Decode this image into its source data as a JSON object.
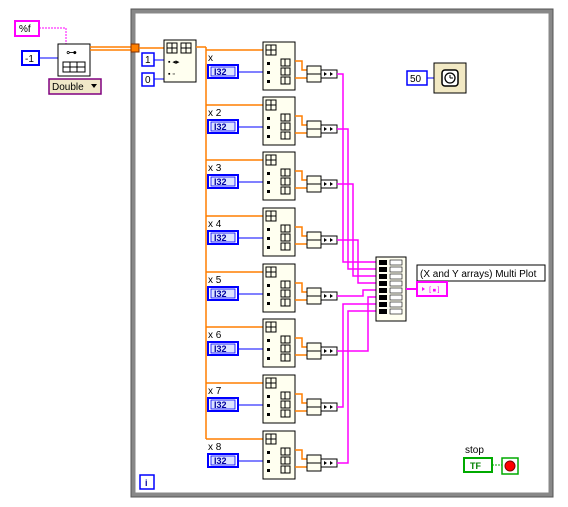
{
  "format_string": "%f",
  "row_constant": "-1",
  "type_selector": "Double",
  "index_start": "1",
  "index_zero": "0",
  "rows": [
    {
      "label": "x",
      "type": "I32"
    },
    {
      "label": "x 2",
      "type": "I32"
    },
    {
      "label": "x 3",
      "type": "I32"
    },
    {
      "label": "x 4",
      "type": "I32"
    },
    {
      "label": "x 5",
      "type": "I32"
    },
    {
      "label": "x 6",
      "type": "I32"
    },
    {
      "label": "x 7",
      "type": "I32"
    },
    {
      "label": "x 8",
      "type": "I32"
    }
  ],
  "wait_ms": "50",
  "graph_label": "(X and Y arrays) Multi Plot",
  "stop_label": "stop",
  "stop_value": "TF",
  "loop_iteration": "i",
  "colors": {
    "dbl_wire": "#ff7f00",
    "cluster_wire": "#ff00ff",
    "int_wire": "#0000ff",
    "bool_wire": "#00aa00",
    "loop_border": "#888888",
    "string_border": "#ff00ff",
    "int_border": "#0000ff"
  }
}
